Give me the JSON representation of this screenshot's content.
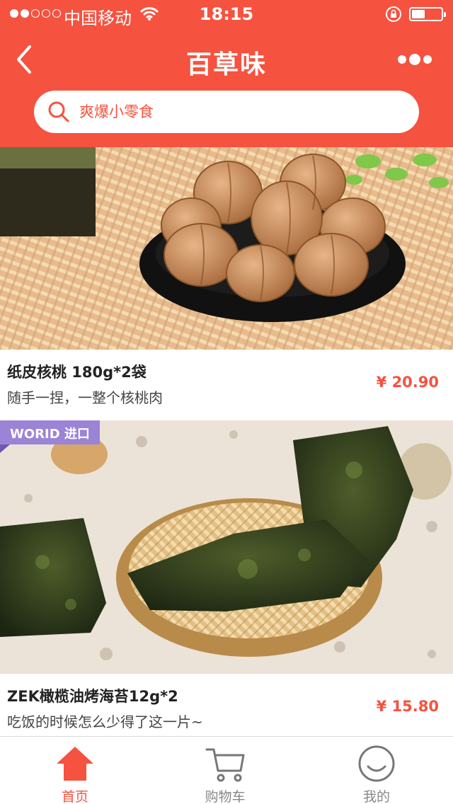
{
  "status_bar": {
    "carrier": "中国移动",
    "time": "18:15",
    "signal_bars": 2,
    "signal_total": 5,
    "icons": [
      "signal-icon",
      "wifi-icon",
      "rotation-lock-icon",
      "battery-icon"
    ]
  },
  "nav": {
    "title": "百草味",
    "back_icon": "chevron-left-icon",
    "more_icon": "more-dots-icon"
  },
  "search": {
    "placeholder": "爽爆小零食",
    "icon": "search-icon"
  },
  "products": [
    {
      "name": "纸皮核桃 180g*2袋",
      "desc": "随手一捏，一整个核桃肉",
      "price": "¥ 20.90"
    },
    {
      "badge": "WORID 进口",
      "name": "ZEK橄榄油烤海苔12g*2",
      "desc": "吃饭的时候怎么少得了这一片~",
      "price": "¥ 15.80"
    }
  ],
  "tabbar": {
    "tabs": [
      {
        "label": "首页",
        "icon": "home-icon",
        "active": true
      },
      {
        "label": "购物车",
        "icon": "cart-icon",
        "active": false
      },
      {
        "label": "我的",
        "icon": "smiley-icon",
        "active": false
      }
    ]
  },
  "colors": {
    "brand": "#f5523f",
    "badge": "#9b84d6",
    "tab_inactive": "#888888"
  }
}
